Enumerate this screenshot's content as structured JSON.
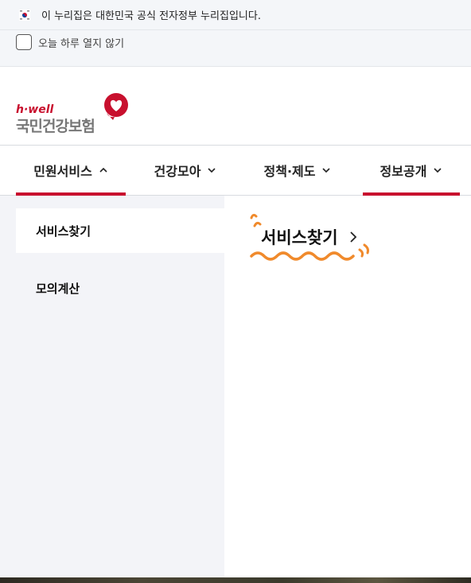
{
  "banner": {
    "official_notice": "이 누리집은 대한민국 공식 전자정부 누리집입니다.",
    "dont_open_today": "오늘 하루 열지 않기"
  },
  "logo": {
    "brand_top": "h·well",
    "brand_name": "국민건강보험",
    "accent_color": "#c8102e"
  },
  "nav": {
    "items": [
      {
        "label": "민원서비스",
        "chevron": "chevron-up-icon"
      },
      {
        "label": "건강모아",
        "chevron": "chevron-down-icon"
      },
      {
        "label": "정책·제도",
        "chevron": "chevron-down-icon"
      },
      {
        "label": "정보공개",
        "chevron": "chevron-down-icon"
      }
    ]
  },
  "submenu": {
    "items": [
      {
        "label": "서비스찾기",
        "selected": true
      },
      {
        "label": "모의계산",
        "selected": false
      }
    ]
  },
  "content": {
    "service_link_label": "서비스찾기",
    "accent_orange": "#f08a2c"
  }
}
